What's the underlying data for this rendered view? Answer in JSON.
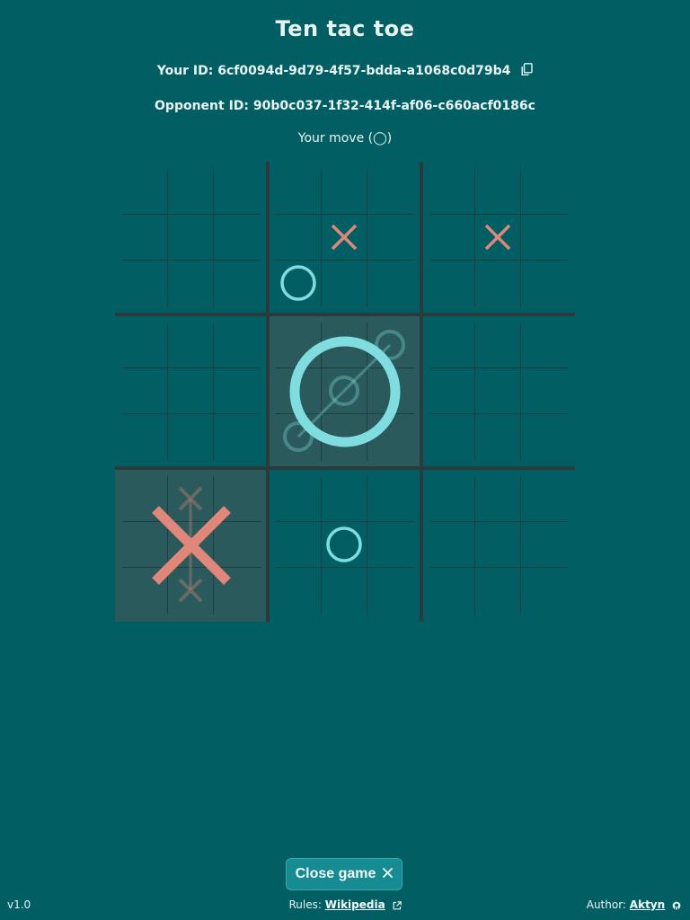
{
  "title": "Ten tac toe",
  "your_id": {
    "label": "Your ID:",
    "value": "6cf0094d-9d79-4f57-bdda-a1068c0d79b4"
  },
  "opponent_id": {
    "label": "Opponent ID:",
    "value": "90b0c037-1f32-414f-af06-c660acf0186c"
  },
  "status": "Your move (◯)",
  "colors": {
    "background": "#015f63",
    "x_mark": "#e0877a",
    "o_mark": "#7fdde0",
    "highlight": "#2a5a5c",
    "grid_thick": "#2b3a3b",
    "grid_thin": "#1f3f40",
    "button": "#168b91"
  },
  "board": {
    "big_winners": [
      {
        "row": 1,
        "col": 1,
        "mark": "O"
      },
      {
        "row": 2,
        "col": 0,
        "mark": "X"
      }
    ],
    "small_marks": [
      {
        "big_row": 0,
        "big_col": 1,
        "row": 1,
        "col": 1,
        "mark": "X"
      },
      {
        "big_row": 0,
        "big_col": 1,
        "row": 2,
        "col": 0,
        "mark": "O"
      },
      {
        "big_row": 0,
        "big_col": 2,
        "row": 1,
        "col": 1,
        "mark": "X"
      },
      {
        "big_row": 2,
        "big_col": 1,
        "row": 1,
        "col": 1,
        "mark": "O"
      }
    ],
    "faded_marks": [
      {
        "big_row": 1,
        "big_col": 1,
        "row": 0,
        "col": 2,
        "mark": "O"
      },
      {
        "big_row": 1,
        "big_col": 1,
        "row": 1,
        "col": 1,
        "mark": "O"
      },
      {
        "big_row": 1,
        "big_col": 1,
        "row": 2,
        "col": 0,
        "mark": "O"
      },
      {
        "big_row": 2,
        "big_col": 0,
        "row": 0,
        "col": 1,
        "mark": "X"
      },
      {
        "big_row": 2,
        "big_col": 0,
        "row": 1,
        "col": 1,
        "mark": "X"
      },
      {
        "big_row": 2,
        "big_col": 0,
        "row": 2,
        "col": 1,
        "mark": "X"
      }
    ]
  },
  "close_button": {
    "label": "Close game",
    "icon": "close-icon"
  },
  "footer": {
    "version": "v1.0",
    "rules_label": "Rules:",
    "rules_link": "Wikipedia",
    "rules_icon": "external-link-icon",
    "author_label": "Author:",
    "author_link": "Aktyn",
    "author_icon": "github-icon"
  }
}
